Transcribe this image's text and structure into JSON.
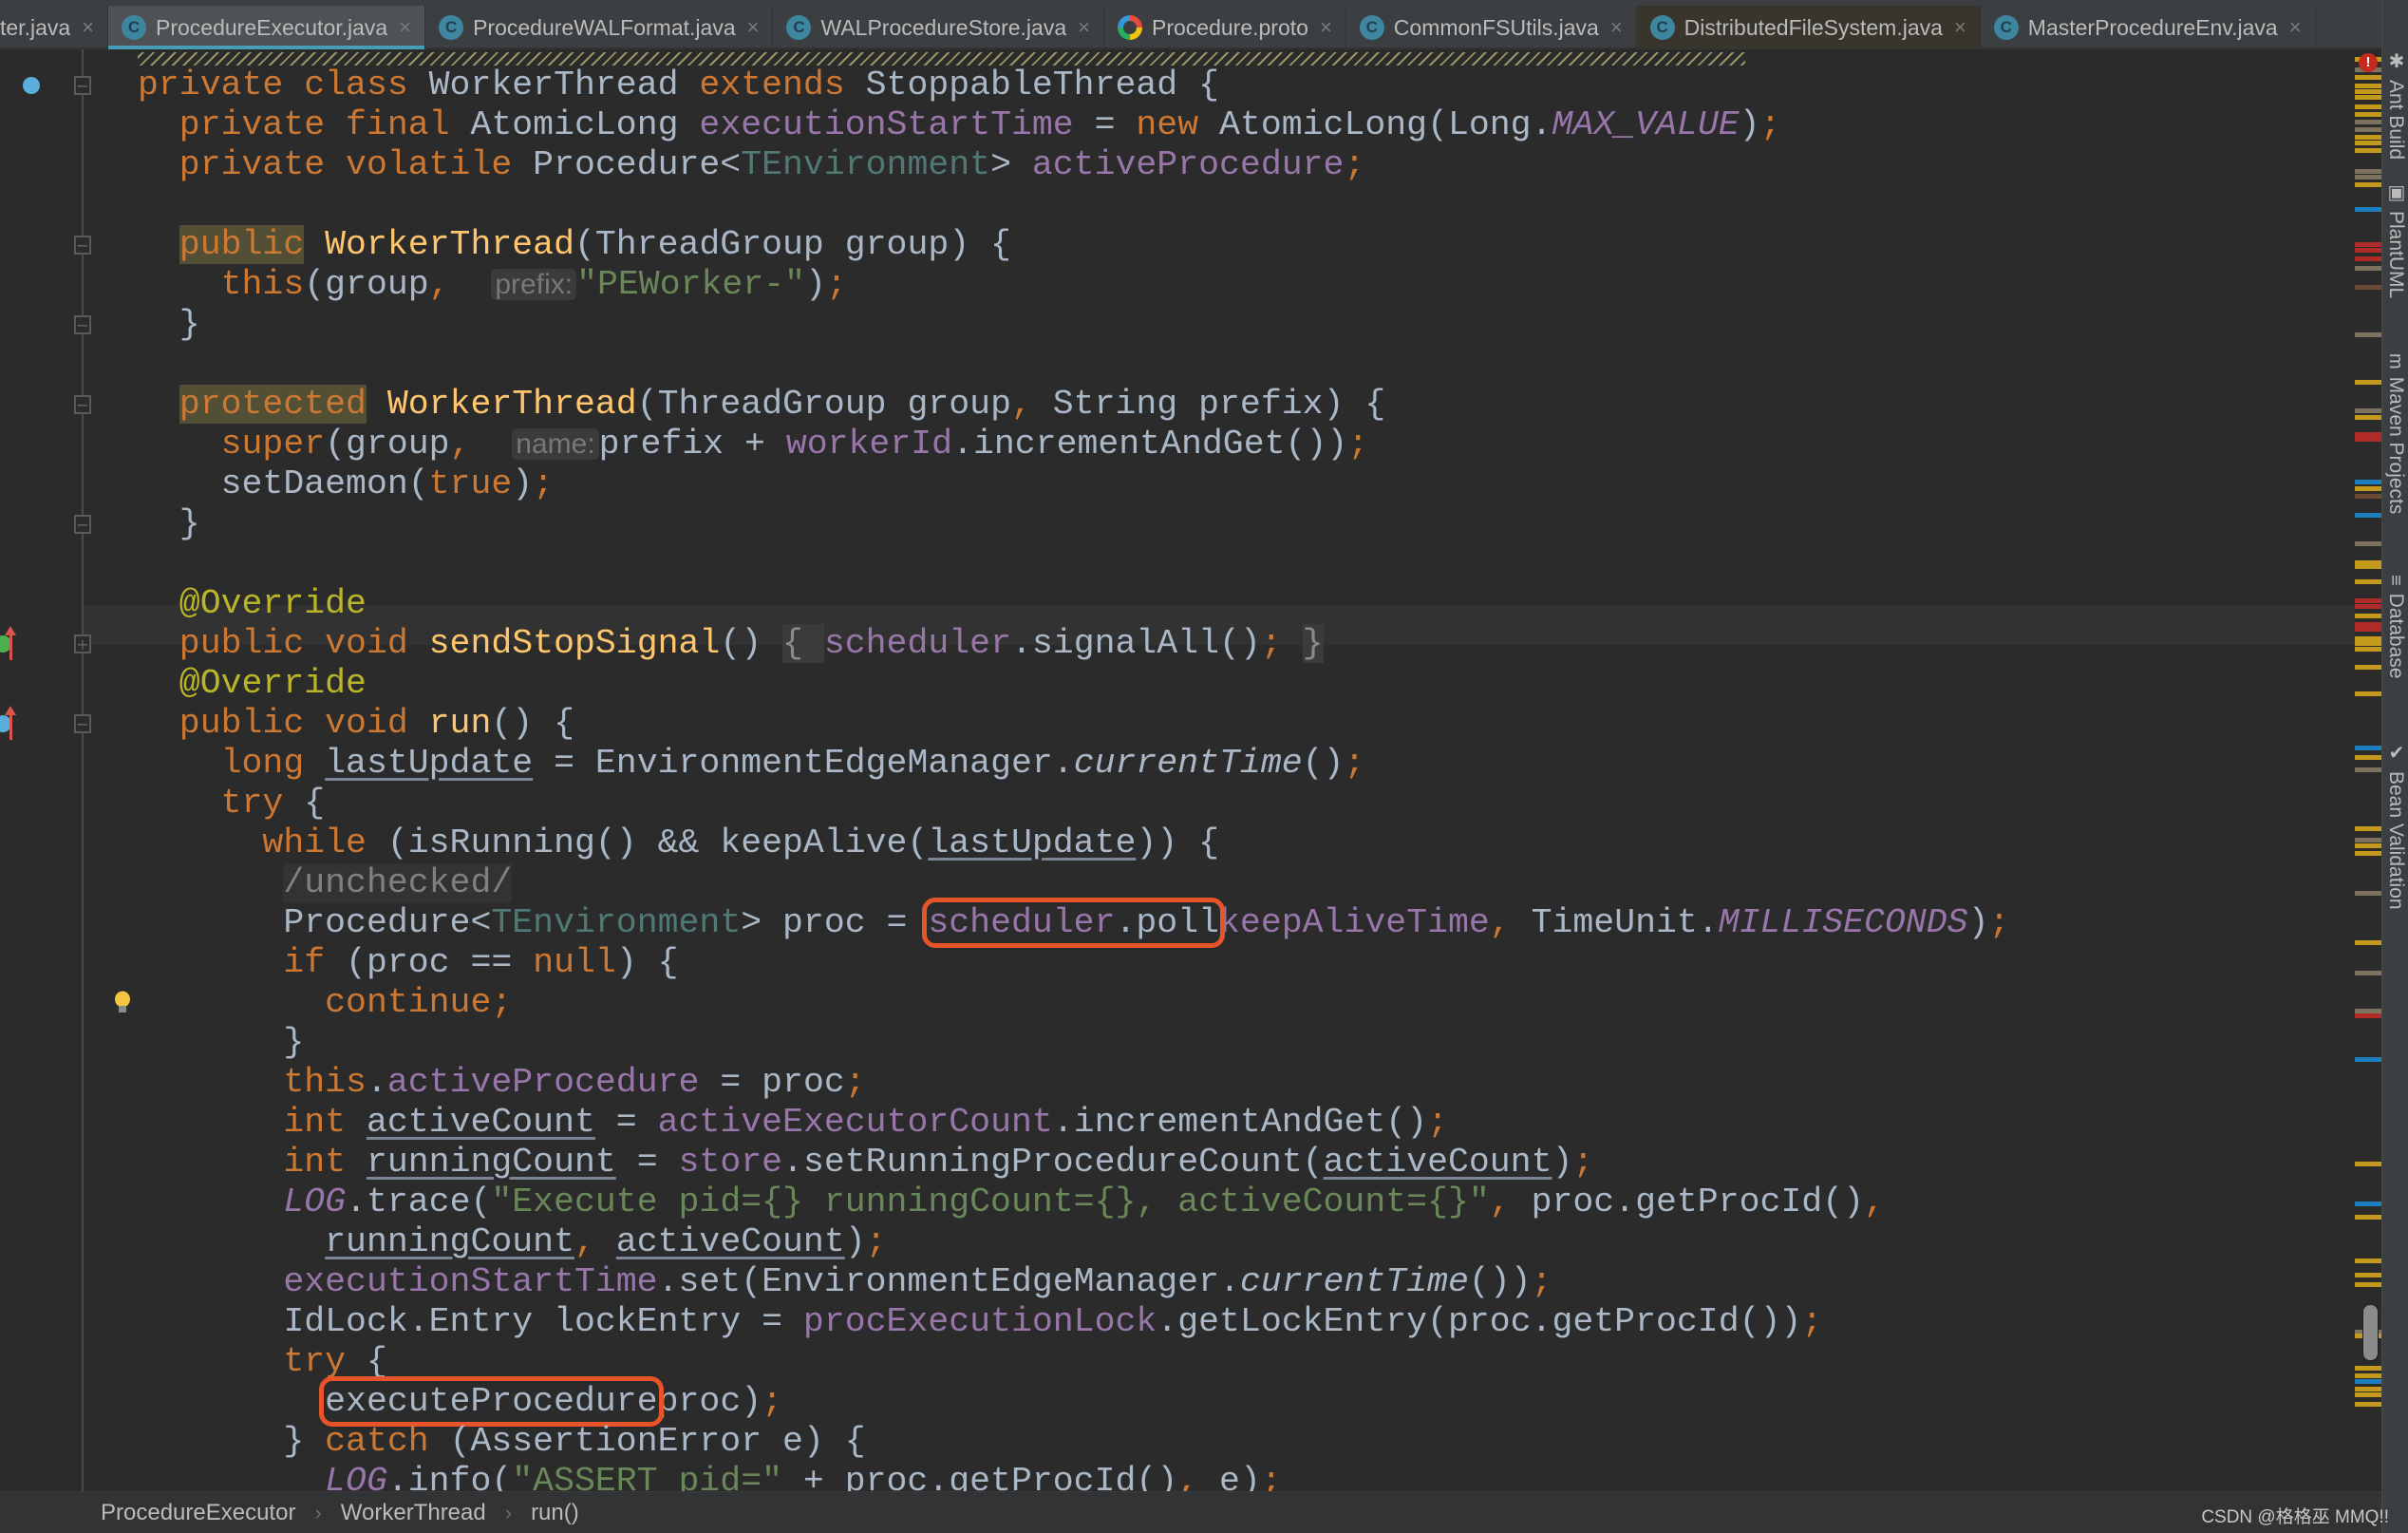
{
  "tabs": [
    {
      "label": "ter.java",
      "icon": "java-class-icon",
      "active": false
    },
    {
      "label": "ProcedureExecutor.java",
      "icon": "java-class-icon",
      "active": true
    },
    {
      "label": "ProcedureWALFormat.java",
      "icon": "java-class-icon",
      "active": false
    },
    {
      "label": "WALProcedureStore.java",
      "icon": "java-class-icon",
      "active": false
    },
    {
      "label": "Procedure.proto",
      "icon": "proto-file-icon",
      "active": false
    },
    {
      "label": "CommonFSUtils.java",
      "icon": "java-class-icon",
      "active": false
    },
    {
      "label": "DistributedFileSystem.java",
      "icon": "java-class-locked-icon",
      "active": false
    },
    {
      "label": "MasterProcedureEnv.java",
      "icon": "java-class-icon",
      "active": false
    }
  ],
  "tab_close_glyph": "×",
  "code": {
    "lines": [
      [
        [
          "kw",
          "private class "
        ],
        [
          "",
          "WorkerThread "
        ],
        [
          "kw",
          "extends "
        ],
        [
          "",
          "StoppableThread {"
        ]
      ],
      [
        [
          "kw",
          "  private final "
        ],
        [
          "",
          "AtomicLong "
        ],
        [
          "fld",
          "executionStartTime"
        ],
        [
          "",
          " = "
        ],
        [
          "kw",
          "new "
        ],
        [
          "",
          "AtomicLong(Long."
        ],
        [
          "fld-i",
          "MAX_VALUE"
        ],
        [
          "",
          ")"
        ],
        [
          "kw",
          ";"
        ]
      ],
      [
        [
          "kw",
          "  private volatile "
        ],
        [
          "",
          "Procedure<"
        ],
        [
          "tp",
          "TEnvironment"
        ],
        [
          "",
          "> "
        ],
        [
          "fld",
          "activeProcedure"
        ],
        [
          "kw",
          ";"
        ]
      ],
      [],
      [
        [
          "",
          "  "
        ],
        [
          "kw hl-kw",
          "public"
        ],
        [
          "",
          " "
        ],
        [
          "fn",
          "WorkerThread"
        ],
        [
          "",
          "(ThreadGroup group) {"
        ]
      ],
      [
        [
          "kw",
          "    this"
        ],
        [
          "",
          "(group"
        ],
        [
          "kw",
          ", "
        ],
        [
          "",
          " "
        ],
        [
          "hint",
          "prefix:"
        ],
        [
          "str",
          "\"PEWorker-\""
        ],
        [
          "",
          ")"
        ],
        [
          "kw",
          ";"
        ]
      ],
      [
        [
          "",
          "  }"
        ]
      ],
      [],
      [
        [
          "",
          "  "
        ],
        [
          "kw hl-kw",
          "protected"
        ],
        [
          "",
          " "
        ],
        [
          "fn",
          "WorkerThread"
        ],
        [
          "",
          "(ThreadGroup group"
        ],
        [
          "kw",
          ", "
        ],
        [
          "",
          "String prefix) {"
        ]
      ],
      [
        [
          "kw",
          "    super"
        ],
        [
          "",
          "(group"
        ],
        [
          "kw",
          ", "
        ],
        [
          "",
          " "
        ],
        [
          "hint",
          "name:"
        ],
        [
          "",
          "prefix + "
        ],
        [
          "fld",
          "workerId"
        ],
        [
          "",
          ".incrementAndGet())"
        ],
        [
          "kw",
          ";"
        ]
      ],
      [
        [
          "",
          "    setDaemon("
        ],
        [
          "kw",
          "true"
        ],
        [
          "",
          ")"
        ],
        [
          "kw",
          ";"
        ]
      ],
      [
        [
          "",
          "  }"
        ]
      ],
      [],
      [
        [
          "ann",
          "  @Override"
        ]
      ],
      [
        [
          "kw",
          "  public void "
        ],
        [
          "fn",
          "sendStopSignal"
        ],
        [
          "",
          "() "
        ],
        [
          "fold-ph",
          "{ "
        ],
        [
          "fld",
          "scheduler"
        ],
        [
          "",
          ".signalAll()"
        ],
        [
          "kw",
          "; "
        ],
        [
          "fold-ph",
          "}"
        ]
      ],
      [
        [
          "ann",
          "  @Override"
        ]
      ],
      [
        [
          "kw",
          "  public void "
        ],
        [
          "fn",
          "run"
        ],
        [
          "",
          "() {"
        ]
      ],
      [
        [
          "kw",
          "    long "
        ],
        [
          "ul",
          "lastUpdate"
        ],
        [
          "",
          " = EnvironmentEdgeManager."
        ],
        [
          "it",
          "currentTime"
        ],
        [
          "",
          "()"
        ],
        [
          "kw",
          ";"
        ]
      ],
      [
        [
          "kw",
          "    try "
        ],
        [
          "",
          "{"
        ]
      ],
      [
        [
          "kw",
          "      while "
        ],
        [
          "",
          "(isRunning() && keepAlive("
        ],
        [
          "ul",
          "lastUpdate"
        ],
        [
          "",
          ")) {"
        ]
      ],
      [
        [
          "",
          "       "
        ],
        [
          "comment-box",
          "/unchecked/"
        ]
      ],
      [
        [
          "",
          "       Procedure<"
        ],
        [
          "tp",
          "TEnvironment"
        ],
        [
          "",
          "> proc = "
        ],
        [
          "mark-open",
          ""
        ],
        [
          "fld",
          "scheduler"
        ],
        [
          "",
          ".poll"
        ],
        [
          "mark-close",
          ""
        ],
        [
          "fld",
          "keepAliveTime"
        ],
        [
          "kw",
          ", "
        ],
        [
          "",
          "TimeUnit."
        ],
        [
          "fld-i",
          "MILLISECONDS"
        ],
        [
          "",
          ")"
        ],
        [
          "kw",
          ";"
        ]
      ],
      [
        [
          "kw",
          "       if "
        ],
        [
          "",
          "(proc == "
        ],
        [
          "kw",
          "null"
        ],
        [
          "",
          ") {"
        ]
      ],
      [
        [
          "kw",
          "         continue;"
        ]
      ],
      [
        [
          "",
          "       }"
        ]
      ],
      [
        [
          "kw",
          "       this"
        ],
        [
          "",
          "."
        ],
        [
          "fld",
          "activeProcedure"
        ],
        [
          "",
          " = proc"
        ],
        [
          "kw",
          ";"
        ]
      ],
      [
        [
          "kw",
          "       int "
        ],
        [
          "ul",
          "activeCount"
        ],
        [
          "",
          " = "
        ],
        [
          "fld",
          "activeExecutorCount"
        ],
        [
          "",
          ".incrementAndGet()"
        ],
        [
          "kw",
          ";"
        ]
      ],
      [
        [
          "kw",
          "       int "
        ],
        [
          "ul",
          "runningCount"
        ],
        [
          "",
          " = "
        ],
        [
          "fld",
          "store"
        ],
        [
          "",
          ".setRunningProcedureCount("
        ],
        [
          "ul",
          "activeCount"
        ],
        [
          "",
          ")"
        ],
        [
          "kw",
          ";"
        ]
      ],
      [
        [
          "fld-i",
          "       LOG"
        ],
        [
          "",
          ".trace("
        ],
        [
          "str",
          "\"Execute pid={} runningCount={}, activeCount={}\""
        ],
        [
          "kw",
          ", "
        ],
        [
          "",
          "proc.getProcId()"
        ],
        [
          "kw",
          ","
        ]
      ],
      [
        [
          "",
          "         "
        ],
        [
          "ul",
          "runningCount"
        ],
        [
          "kw",
          ", "
        ],
        [
          "ul",
          "activeCount"
        ],
        [
          "",
          ")"
        ],
        [
          "kw",
          ";"
        ]
      ],
      [
        [
          "fld",
          "       executionStartTime"
        ],
        [
          "",
          ".set(EnvironmentEdgeManager."
        ],
        [
          "it",
          "currentTime"
        ],
        [
          "",
          "())"
        ],
        [
          "kw",
          ";"
        ]
      ],
      [
        [
          "",
          "       IdLock.Entry lockEntry = "
        ],
        [
          "fld",
          "procExecutionLock"
        ],
        [
          "",
          ".getLockEntry(proc.getProcId())"
        ],
        [
          "kw",
          ";"
        ]
      ],
      [
        [
          "kw",
          "       try "
        ],
        [
          "",
          "{"
        ]
      ],
      [
        [
          "",
          "         "
        ],
        [
          "mark-open",
          ""
        ],
        [
          "",
          "executeProcedure"
        ],
        [
          "mark-close",
          ""
        ],
        [
          "",
          "proc)"
        ],
        [
          "kw",
          ";"
        ]
      ],
      [
        [
          "",
          "       } "
        ],
        [
          "kw",
          "catch "
        ],
        [
          "",
          "(AssertionError e) {"
        ]
      ],
      [
        [
          "fld-i",
          "         LOG"
        ],
        [
          "",
          ".info("
        ],
        [
          "str",
          "\"ASSERT pid=\""
        ],
        [
          "",
          " + proc.getProcId()"
        ],
        [
          "kw",
          ", "
        ],
        [
          "",
          "e)"
        ],
        [
          "kw",
          ";"
        ]
      ]
    ]
  },
  "highlights": [
    {
      "label": "scheduler.poll",
      "color": "#e8542a"
    },
    {
      "label": "executeProcedure",
      "color": "#e8542a"
    }
  ],
  "colors": {
    "keyword": "#cc7832",
    "function_decl": "#ffc66d",
    "field": "#9876aa",
    "string": "#6a8759",
    "annotation": "#bbb529",
    "type_param": "#507874",
    "default_text": "#a9b7c6",
    "editor_bg": "#2b2b2b",
    "annotation_box": "#e8542a",
    "active_tab_underline": "#4a9bb5"
  },
  "tool_windows": [
    {
      "label": "Ant Build",
      "icon": "ant-icon"
    },
    {
      "label": "PlantUML",
      "icon": "plantuml-icon"
    },
    {
      "label": "Maven Projects",
      "icon": "maven-icon"
    },
    {
      "label": "Database",
      "icon": "database-icon"
    },
    {
      "label": "Bean Validation",
      "icon": "bean-validation-icon"
    }
  ],
  "breadcrumbs": [
    "ProcedureExecutor",
    "WorkerThread",
    "run()"
  ],
  "breadcrumb_sep": "›",
  "error_badge": "!",
  "watermark": "CSDN @格格巫 MMQ!!"
}
